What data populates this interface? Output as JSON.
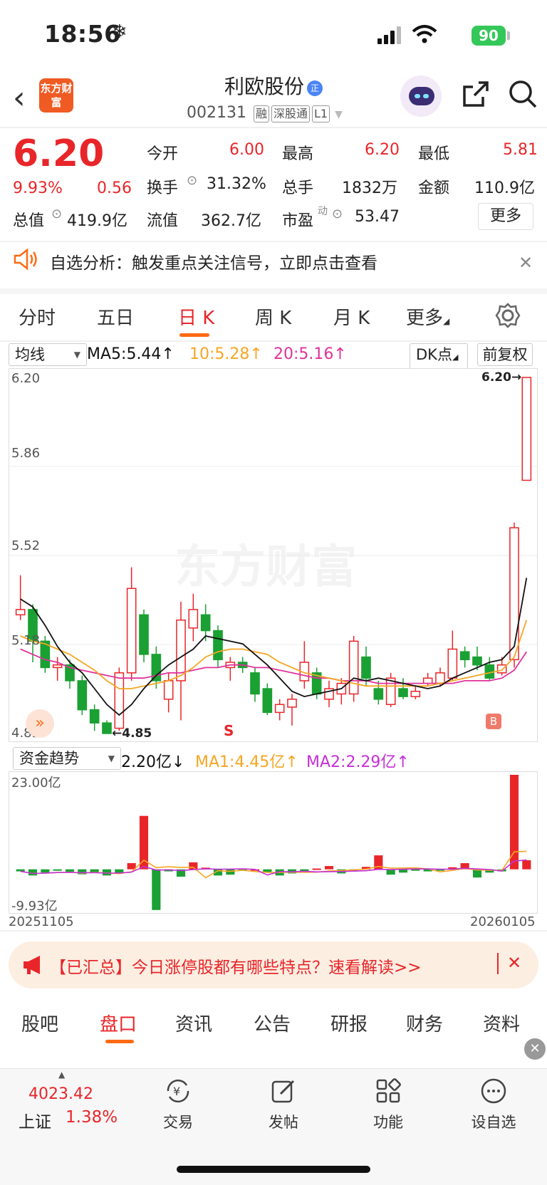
{
  "status_bar": {
    "time": "18:56",
    "battery": "90"
  },
  "header": {
    "logo_text": "东方财富",
    "title": "利欧股份",
    "badge": "正",
    "code": "002131",
    "tags": [
      "融",
      "深股通",
      "L1"
    ]
  },
  "quote": {
    "price": "6.20",
    "change_pct": "9.93%",
    "change": "0.56",
    "open_label": "今开",
    "open": "6.00",
    "high_label": "最高",
    "high": "6.20",
    "low_label": "最低",
    "low": "5.81",
    "turnover_label": "换手",
    "turnover": "31.32%",
    "volume_label": "总手",
    "volume": "1832万",
    "amount_label": "金额",
    "amount": "110.9亿",
    "mktcap_label": "总值",
    "mktcap": "419.9亿",
    "float_label": "流值",
    "float": "362.7亿",
    "pe_label": "市盈",
    "pe_sup": "动",
    "pe": "53.47",
    "more": "更多"
  },
  "notice": {
    "text": "自选分析：触发重点关注信号，立即点击查看"
  },
  "tabs": [
    "分时",
    "五日",
    "日 K",
    "周 K",
    "月 K",
    "更多"
  ],
  "kline": {
    "indicator_select": "均线",
    "ma5": "MA5:5.44",
    "ma10": "10:5.28",
    "ma20": "20:5.16",
    "dk_button": "DK点",
    "adjust_button": "前复权",
    "y_labels": [
      "6.20",
      "5.86",
      "5.52",
      "5.18",
      "4.85"
    ],
    "max_marker": "6.20",
    "min_marker": "4.85",
    "sell_marker": "S",
    "buy_marker": "B",
    "watermark": "东方财富",
    "ma5_color": "#111111",
    "ma10_color": "#f5a623",
    "ma20_color": "#e0329b",
    "up_color": "#e8262a",
    "down_color": "#1aa033"
  },
  "capital": {
    "select": "资金趋势",
    "value": "2.20亿",
    "ma1": "MA1:4.45亿",
    "ma2": "MA2:2.29亿",
    "y_top": "23.00亿",
    "y_bottom": "-9.93亿",
    "date_start": "20251105",
    "date_end": "20260105"
  },
  "chart_data": {
    "type": "candlestick",
    "price_range": [
      4.85,
      6.2
    ],
    "candles": [
      [
        5.3,
        5.32,
        5.45,
        5.28
      ],
      [
        5.32,
        5.2,
        5.34,
        5.12
      ],
      [
        5.2,
        5.1,
        5.22,
        5.08
      ],
      [
        5.1,
        5.11,
        5.14,
        5.05
      ],
      [
        5.11,
        5.05,
        5.13,
        5.02
      ],
      [
        5.05,
        4.94,
        5.07,
        4.92
      ],
      [
        4.94,
        4.89,
        4.96,
        4.86
      ],
      [
        4.89,
        4.85,
        4.9,
        4.85
      ],
      [
        4.87,
        5.08,
        5.1,
        4.86
      ],
      [
        5.08,
        5.4,
        5.48,
        5.05
      ],
      [
        5.3,
        5.15,
        5.32,
        5.12
      ],
      [
        5.15,
        5.05,
        5.18,
        5.02
      ],
      [
        4.98,
        5.05,
        5.08,
        4.93
      ],
      [
        5.05,
        5.28,
        5.35,
        4.9
      ],
      [
        5.25,
        5.32,
        5.38,
        5.2
      ],
      [
        5.3,
        5.24,
        5.34,
        5.2
      ],
      [
        5.24,
        5.13,
        5.26,
        5.1
      ],
      [
        5.1,
        5.12,
        5.14,
        5.05
      ],
      [
        5.12,
        5.1,
        5.14,
        5.08
      ],
      [
        5.08,
        5.0,
        5.1,
        4.97
      ],
      [
        5.02,
        4.93,
        5.04,
        4.92
      ],
      [
        4.93,
        4.96,
        4.98,
        4.9
      ],
      [
        4.95,
        4.98,
        5.0,
        4.88
      ],
      [
        5.05,
        5.12,
        5.2,
        5.02
      ],
      [
        5.08,
        5.0,
        5.1,
        4.98
      ],
      [
        4.98,
        5.02,
        5.05,
        4.95
      ],
      [
        5.0,
        5.04,
        5.06,
        4.96
      ],
      [
        5.0,
        5.2,
        5.22,
        4.97
      ],
      [
        5.14,
        5.06,
        5.18,
        5.03
      ],
      [
        5.02,
        4.98,
        5.05,
        4.96
      ],
      [
        4.96,
        5.06,
        5.08,
        4.95
      ],
      [
        5.02,
        4.99,
        5.06,
        4.98
      ],
      [
        4.99,
        5.01,
        5.03,
        4.98
      ],
      [
        5.04,
        5.06,
        5.08,
        5.03
      ],
      [
        5.04,
        5.08,
        5.1,
        5.03
      ],
      [
        5.06,
        5.17,
        5.24,
        5.05
      ],
      [
        5.16,
        5.13,
        5.18,
        5.1
      ],
      [
        5.14,
        5.11,
        5.18,
        5.09
      ],
      [
        5.11,
        5.06,
        5.14,
        5.05
      ],
      [
        5.08,
        5.11,
        5.14,
        5.07
      ],
      [
        5.13,
        5.63,
        5.65,
        5.1
      ],
      [
        5.81,
        6.2,
        6.2,
        5.81
      ]
    ],
    "ma5": [
      5.36,
      5.33,
      5.26,
      5.18,
      5.12,
      5.08,
      5.02,
      4.96,
      4.92,
      4.96,
      5.02,
      5.07,
      5.11,
      5.14,
      5.17,
      5.22,
      5.21,
      5.2,
      5.19,
      5.15,
      5.11,
      5.06,
      5.01,
      4.99,
      5.0,
      5.01,
      5.02,
      5.06,
      5.05,
      5.06,
      5.05,
      5.04,
      5.03,
      5.02,
      5.03,
      5.06,
      5.08,
      5.1,
      5.12,
      5.13,
      5.18,
      5.44
    ],
    "ma10": [
      5.22,
      5.2,
      5.19,
      5.17,
      5.15,
      5.12,
      5.09,
      5.05,
      5.02,
      5.02,
      5.03,
      5.04,
      5.05,
      5.07,
      5.1,
      5.14,
      5.16,
      5.17,
      5.17,
      5.16,
      5.15,
      5.12,
      5.1,
      5.08,
      5.07,
      5.06,
      5.05,
      5.04,
      5.03,
      5.03,
      5.03,
      5.03,
      5.03,
      5.03,
      5.04,
      5.05,
      5.06,
      5.07,
      5.08,
      5.09,
      5.14,
      5.28
    ],
    "ma20": [
      5.17,
      5.15,
      5.13,
      5.12,
      5.1,
      5.09,
      5.08,
      5.07,
      5.06,
      5.06,
      5.06,
      5.07,
      5.08,
      5.08,
      5.09,
      5.1,
      5.1,
      5.11,
      5.11,
      5.1,
      5.1,
      5.09,
      5.08,
      5.07,
      5.06,
      5.06,
      5.05,
      5.05,
      5.05,
      5.04,
      5.04,
      5.04,
      5.04,
      5.04,
      5.04,
      5.04,
      5.05,
      5.05,
      5.05,
      5.06,
      5.09,
      5.16
    ],
    "capital_range": [
      -9.93,
      23.0
    ],
    "capital": [
      -0.5,
      -1.5,
      -0.8,
      -0.3,
      -0.6,
      -1.2,
      -0.9,
      -1.5,
      -1.0,
      1.5,
      13.0,
      -9.9,
      -0.5,
      -1.8,
      1.7,
      0.4,
      -1.5,
      -1.3,
      -0.3,
      0.0,
      -0.7,
      -1.5,
      -1.0,
      -0.5,
      0.2,
      0.8,
      -1.0,
      -0.3,
      0.6,
      3.4,
      -1.3,
      -0.8,
      -0.2,
      -0.5,
      -0.3,
      0.5,
      1.5,
      -2.0,
      -0.8,
      -0.5,
      23.0,
      2.2
    ]
  },
  "banner": {
    "text": "【已汇总】今日涨停股都有哪些特点？速看解读>>"
  },
  "bottom_tabs": [
    "股吧",
    "盘口",
    "资讯",
    "公告",
    "研报",
    "财务",
    "资料"
  ],
  "bottom_nav": {
    "index_value": "4023.42",
    "index_name": "上证",
    "index_change": "1.38%",
    "items": [
      "交易",
      "发帖",
      "功能",
      "设自选"
    ]
  }
}
